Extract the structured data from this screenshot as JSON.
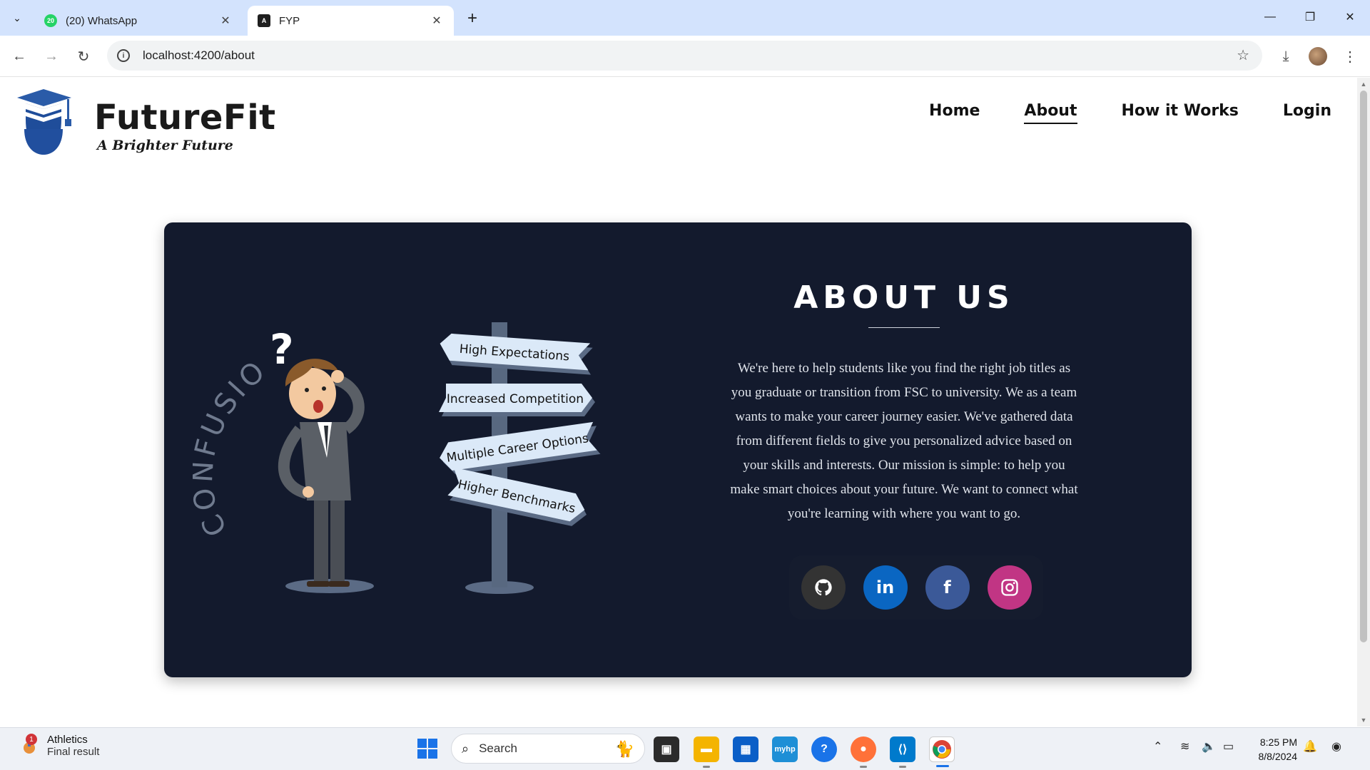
{
  "browser": {
    "tabs": [
      {
        "title": "(20) WhatsApp",
        "favicon": "whatsapp-icon",
        "badge": "20",
        "active": false
      },
      {
        "title": "FYP",
        "favicon": "angular-icon",
        "active": true
      }
    ],
    "url": "localhost:4200/about"
  },
  "header": {
    "brand_name": "FutureFit",
    "tagline": "A Brighter Future",
    "nav": [
      {
        "label": "Home",
        "active": false
      },
      {
        "label": "About",
        "active": true
      },
      {
        "label": "How it Works",
        "active": false
      },
      {
        "label": "Login",
        "active": false
      }
    ]
  },
  "illustration": {
    "word": "CONFUSION",
    "signs": [
      "High Expectations",
      "Increased Competition",
      "Multiple Career Options",
      "Higher Benchmarks"
    ]
  },
  "about": {
    "title": "ABOUT US",
    "body": "We're here to help students like you find the right job titles as you graduate or transition from FSC to university. We as a team wants to make your career journey easier. We've gathered data from different fields to give you personalized advice based on your skills and interests. Our mission is simple: to help you make smart choices about your future. We want to connect what you're learning with where you want to go."
  },
  "socials": [
    {
      "name": "github-icon",
      "color": "#333333"
    },
    {
      "name": "linkedin-icon",
      "color": "#0a66c2"
    },
    {
      "name": "facebook-icon",
      "color": "#3b5998"
    },
    {
      "name": "instagram-icon",
      "color": "#c13584"
    }
  ],
  "taskbar": {
    "widget_title": "Athletics",
    "widget_subtitle": "Final result",
    "widget_badge": "1",
    "search_placeholder": "Search",
    "time": "8:25 PM",
    "date": "8/8/2024"
  },
  "colors": {
    "card_background": "#131a2d",
    "tabbar": "#d3e3fd"
  }
}
